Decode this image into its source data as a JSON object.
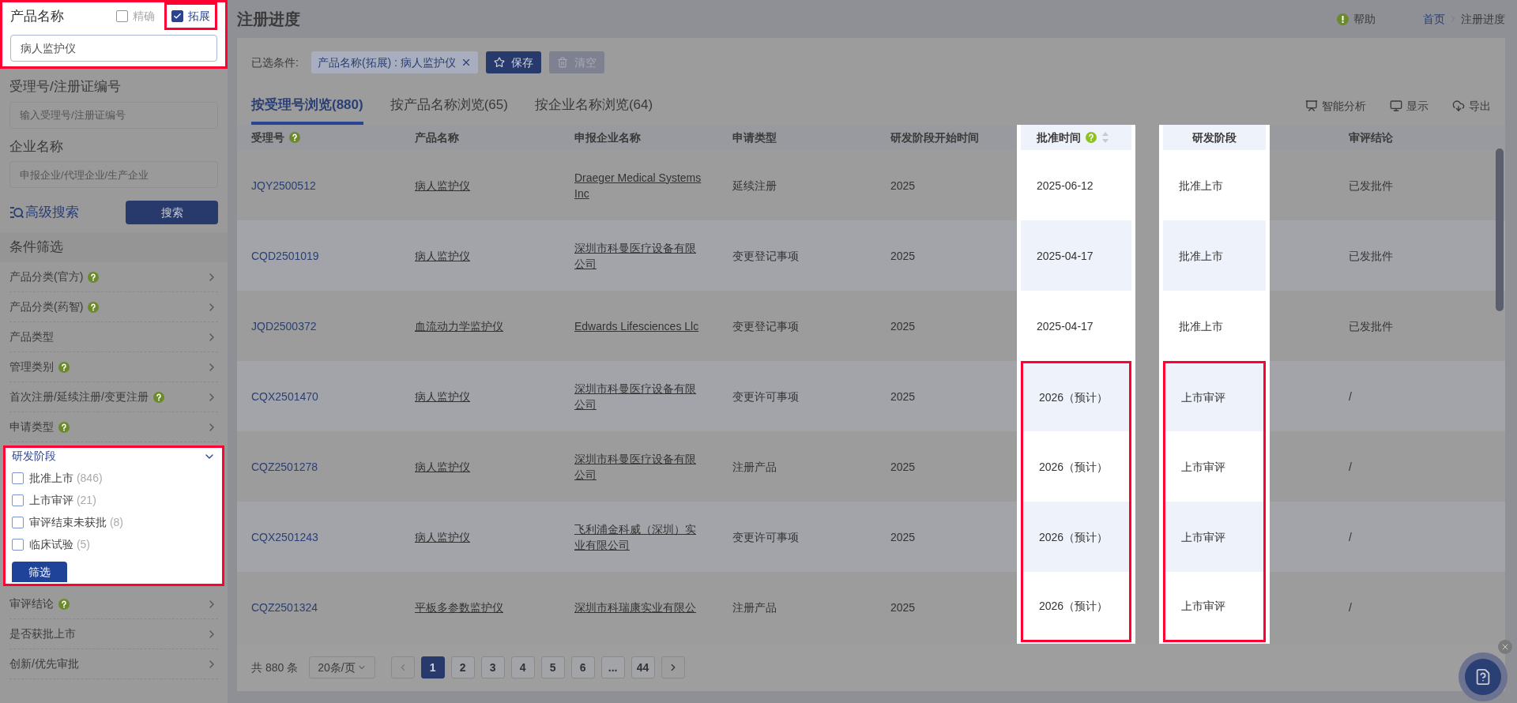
{
  "sidebar": {
    "product_name": {
      "label": "产品名称",
      "highlighted": true,
      "value": "病人监护仪",
      "options": [
        {
          "label": "精确",
          "checked": false,
          "highlighted": false
        },
        {
          "label": "拓展",
          "checked": true,
          "highlighted": true
        }
      ]
    },
    "fields": [
      {
        "label": "受理号/注册证编号",
        "placeholder": "输入受理号/注册证编号"
      },
      {
        "label": "企业名称",
        "placeholder": "申报企业/代理企业/生产企业"
      }
    ],
    "advanced_search": "高级搜索",
    "search_button": "搜索",
    "filter_title": "条件筛选",
    "filters": [
      {
        "label": "产品分类(官方)",
        "help": true,
        "expanded": false,
        "highlighted": false
      },
      {
        "label": "产品分类(药智)",
        "help": true,
        "expanded": false,
        "highlighted": false
      },
      {
        "label": "产品类型",
        "help": false,
        "expanded": false,
        "highlighted": false
      },
      {
        "label": "管理类别",
        "help": true,
        "expanded": false,
        "highlighted": false
      },
      {
        "label": "首次注册/延续注册/变更注册",
        "help": true,
        "expanded": false,
        "highlighted": false
      },
      {
        "label": "申请类型",
        "help": true,
        "expanded": false,
        "highlighted": false
      },
      {
        "label": "研发阶段",
        "help": false,
        "expanded": true,
        "highlighted": true,
        "apply": "筛选",
        "options": [
          {
            "label": "批准上市",
            "count": "(846)",
            "checked": false
          },
          {
            "label": "上市审评",
            "count": "(21)",
            "checked": false
          },
          {
            "label": "审评结束未获批",
            "count": "(8)",
            "checked": false
          },
          {
            "label": "临床试验",
            "count": "(5)",
            "checked": false
          }
        ]
      },
      {
        "label": "审评结论",
        "help": true,
        "expanded": false,
        "highlighted": false
      },
      {
        "label": "是否获批上市",
        "help": false,
        "expanded": false,
        "highlighted": false
      },
      {
        "label": "创新/优先审批",
        "help": false,
        "expanded": false,
        "highlighted": false
      }
    ]
  },
  "header": {
    "title": "注册进度",
    "help": "帮助",
    "breadcrumb": [
      "首页",
      "注册进度"
    ]
  },
  "conditions": {
    "label": "已选条件:",
    "tags": [
      "产品名称(拓展) : 病人监护仪"
    ],
    "save": "保存",
    "clear": "清空",
    "clear_disabled": true
  },
  "tabs": [
    {
      "label": "按受理号浏览(880)",
      "selected": true
    },
    {
      "label": "按产品名称浏览(65)",
      "selected": false
    },
    {
      "label": "按企业名称浏览(64)",
      "selected": false
    }
  ],
  "tools": [
    {
      "kind": "analysis",
      "label": "智能分析"
    },
    {
      "kind": "display",
      "label": "显示"
    },
    {
      "kind": "export",
      "label": "导出"
    }
  ],
  "table": {
    "columns": [
      {
        "label": "受理号",
        "kind": "link",
        "help": true,
        "sortable": false,
        "highlighted": false
      },
      {
        "label": "产品名称",
        "kind": "underlined",
        "help": false,
        "sortable": false,
        "highlighted": false
      },
      {
        "label": "申报企业名称",
        "kind": "underlined",
        "help": false,
        "sortable": false,
        "highlighted": false
      },
      {
        "label": "申请类型",
        "kind": "text",
        "help": false,
        "sortable": false,
        "highlighted": false
      },
      {
        "label": "研发阶段开始时间",
        "kind": "text",
        "help": false,
        "sortable": false,
        "highlighted": false
      },
      {
        "label": "批准时间",
        "kind": "text",
        "help": true,
        "sortable": true,
        "highlighted": true
      },
      {
        "label": "研发阶段",
        "kind": "center",
        "help": false,
        "sortable": false,
        "highlighted": true
      },
      {
        "label": "审评结论",
        "kind": "text",
        "help": false,
        "sortable": false,
        "highlighted": false
      }
    ],
    "rows": [
      {
        "marked": false,
        "cells": [
          "JQY2500512",
          "病人监护仪",
          "Draeger Medical Systems Inc",
          "延续注册",
          "2025",
          "2025-06-12",
          "批准上市",
          "已发批件"
        ]
      },
      {
        "marked": false,
        "cells": [
          "CQD2501019",
          "病人监护仪",
          "深圳市科曼医疗设备有限公司",
          "变更登记事项",
          "2025",
          "2025-04-17",
          "批准上市",
          "已发批件"
        ]
      },
      {
        "marked": false,
        "cells": [
          "JQD2500372",
          "血流动力学监护仪",
          "Edwards Lifesciences Llc",
          "变更登记事项",
          "2025",
          "2025-04-17",
          "批准上市",
          "已发批件"
        ]
      },
      {
        "marked": true,
        "cells": [
          "CQX2501470",
          "病人监护仪",
          "深圳市科曼医疗设备有限公司",
          "变更许可事项",
          "2025",
          "2026（预计）",
          "上市审评",
          "/"
        ]
      },
      {
        "marked": true,
        "cells": [
          "CQZ2501278",
          "病人监护仪",
          "深圳市科曼医疗设备有限公司",
          "注册产品",
          "2025",
          "2026（预计）",
          "上市审评",
          "/"
        ]
      },
      {
        "marked": true,
        "cells": [
          "CQX2501243",
          "病人监护仪",
          "飞利浦金科威（深圳）实业有限公司",
          "变更许可事项",
          "2025",
          "2026（预计）",
          "上市审评",
          "/"
        ]
      },
      {
        "marked": true,
        "cells": [
          "CQZ2501324",
          "平板多参数监护仪",
          "深圳市科瑞康实业有限公",
          "注册产品",
          "2025",
          "2026（预计）",
          "上市审评",
          "/"
        ]
      }
    ]
  },
  "pagination": {
    "total": "共 880 条",
    "page_size": "20条/页",
    "pages": [
      {
        "label": "1",
        "selected": true
      },
      {
        "label": "2",
        "selected": false
      },
      {
        "label": "3",
        "selected": false
      },
      {
        "label": "4",
        "selected": false
      },
      {
        "label": "5",
        "selected": false
      },
      {
        "label": "6",
        "selected": false
      },
      {
        "label": "...",
        "selected": false
      },
      {
        "label": "44",
        "selected": false
      }
    ]
  }
}
